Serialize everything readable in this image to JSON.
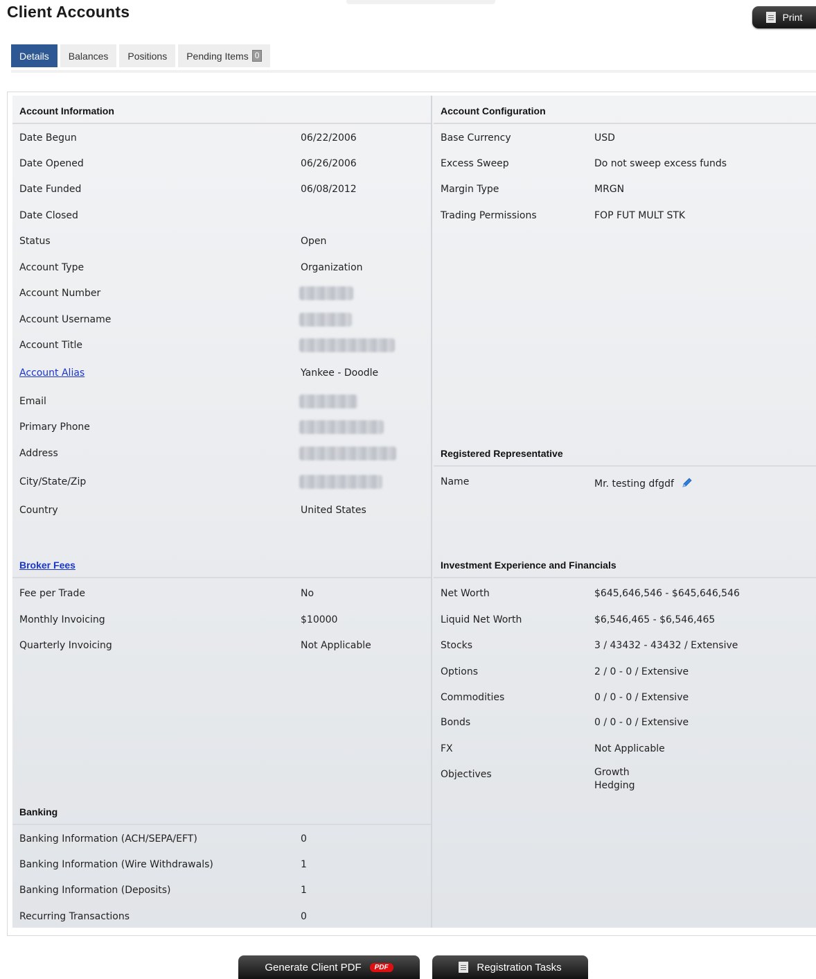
{
  "header": {
    "title": "Client Accounts",
    "print_label": "Print"
  },
  "tabs": [
    {
      "label": "Details",
      "active": true
    },
    {
      "label": "Balances",
      "active": false
    },
    {
      "label": "Positions",
      "active": false
    },
    {
      "label": "Pending Items",
      "active": false,
      "count": "0"
    }
  ],
  "account_information": {
    "title": "Account Information",
    "rows": [
      {
        "label": "Date Begun",
        "value": "06/22/2006"
      },
      {
        "label": "Date Opened",
        "value": "06/26/2006"
      },
      {
        "label": "Date Funded",
        "value": "06/08/2012"
      },
      {
        "label": "Date Closed",
        "value": ""
      },
      {
        "label": "Status",
        "value": "Open"
      },
      {
        "label": "Account Type",
        "value": "Organization"
      },
      {
        "label": "Account Number",
        "value": ""
      },
      {
        "label": "Account Username",
        "value": ""
      },
      {
        "label": "Account Title",
        "value": ""
      },
      {
        "label": "Account Alias",
        "value": "Yankee - Doodle"
      },
      {
        "label": "Email",
        "value": ""
      },
      {
        "label": "Primary Phone",
        "value": ""
      },
      {
        "label": "Address",
        "value": ""
      },
      {
        "label": "City/State/Zip",
        "value": ""
      },
      {
        "label": "Country",
        "value": "United States"
      }
    ]
  },
  "broker_fees": {
    "title": "Broker Fees",
    "rows": [
      {
        "label": "Fee per Trade",
        "value": "No"
      },
      {
        "label": "Monthly Invoicing",
        "value": "$10000"
      },
      {
        "label": "Quarterly Invoicing",
        "value": "Not Applicable"
      }
    ]
  },
  "banking": {
    "title": "Banking",
    "rows": [
      {
        "label": "Banking Information (ACH/SEPA/EFT)",
        "value": "0"
      },
      {
        "label": "Banking Information (Wire Withdrawals)",
        "value": "1"
      },
      {
        "label": "Banking Information (Deposits)",
        "value": "1"
      },
      {
        "label": "Recurring Transactions",
        "value": "0"
      }
    ]
  },
  "account_configuration": {
    "title": "Account Configuration",
    "rows": [
      {
        "label": "Base Currency",
        "value": "USD"
      },
      {
        "label": "Excess Sweep",
        "value": "Do not sweep excess funds"
      },
      {
        "label": "Margin Type",
        "value": "MRGN"
      },
      {
        "label": "Trading Permissions",
        "value": "FOP FUT MULT STK"
      }
    ]
  },
  "registered_representative": {
    "title": "Registered Representative",
    "rows": [
      {
        "label": "Name",
        "value": "Mr. testing dfgdf"
      }
    ]
  },
  "investment": {
    "title": "Investment Experience and Financials",
    "rows": [
      {
        "label": "Net Worth",
        "value": "$645,646,546 - $645,646,546"
      },
      {
        "label": "Liquid Net Worth",
        "value": "$6,546,465 - $6,546,465"
      },
      {
        "label": "Stocks",
        "value": "3 / 43432 - 43432 / Extensive"
      },
      {
        "label": "Options",
        "value": "2 / 0 - 0 / Extensive"
      },
      {
        "label": "Commodities",
        "value": "0 / 0 - 0 / Extensive"
      },
      {
        "label": "Bonds",
        "value": "0 / 0 - 0 / Extensive"
      },
      {
        "label": "FX",
        "value": "Not Applicable"
      },
      {
        "label": "Objectives",
        "value": "Growth"
      }
    ],
    "objectives_extra": "Hedging"
  },
  "footer": {
    "generate_pdf_label": "Generate Client PDF",
    "pdf_badge": "PDF",
    "registration_tasks_label": "Registration Tasks"
  },
  "colors": {
    "tab_active": "#2e5893",
    "link": "#1a35c8",
    "pencil": "#2f7fd8"
  }
}
